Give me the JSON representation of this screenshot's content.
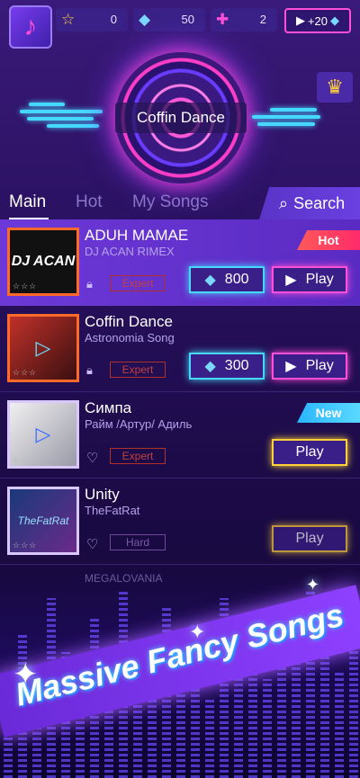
{
  "topbar": {
    "stars": "0",
    "gems": "50",
    "plus": "2",
    "ad_reward": "+20"
  },
  "hero": {
    "now_playing": "Coffin Dance"
  },
  "tabs": {
    "main": "Main",
    "hot": "Hot",
    "my_songs": "My Songs",
    "search": "Search"
  },
  "songs": [
    {
      "title": "ADUH MAMAE",
      "artist": "DJ ACAN RIMEX",
      "difficulty": "Expert",
      "gems": "800",
      "play": "Play",
      "badge": "Hot",
      "art_text": "DJ ACAN"
    },
    {
      "title": "Coffin Dance",
      "artist": "Astronomia Song",
      "difficulty": "Expert",
      "gems": "300",
      "play": "Play",
      "badge": ""
    },
    {
      "title": "Симпа",
      "artist": "Райм /Артур/ Адиль",
      "difficulty": "Expert",
      "play": "Play",
      "badge": "New"
    },
    {
      "title": "Unity",
      "artist": "TheFatRat",
      "difficulty": "Hard",
      "play": "Play",
      "badge": "",
      "art_text": "TheFatRat"
    }
  ],
  "partial_next": "MEGALOVANIA",
  "promo": {
    "text": "Massive Fancy Songs"
  },
  "colors": {
    "accent_pink": "#ff4fd8",
    "accent_cyan": "#46d8ff",
    "accent_gold": "#ffd23a",
    "hot_badge": "#ff3a5a",
    "new_badge": "#2ab6ff"
  }
}
